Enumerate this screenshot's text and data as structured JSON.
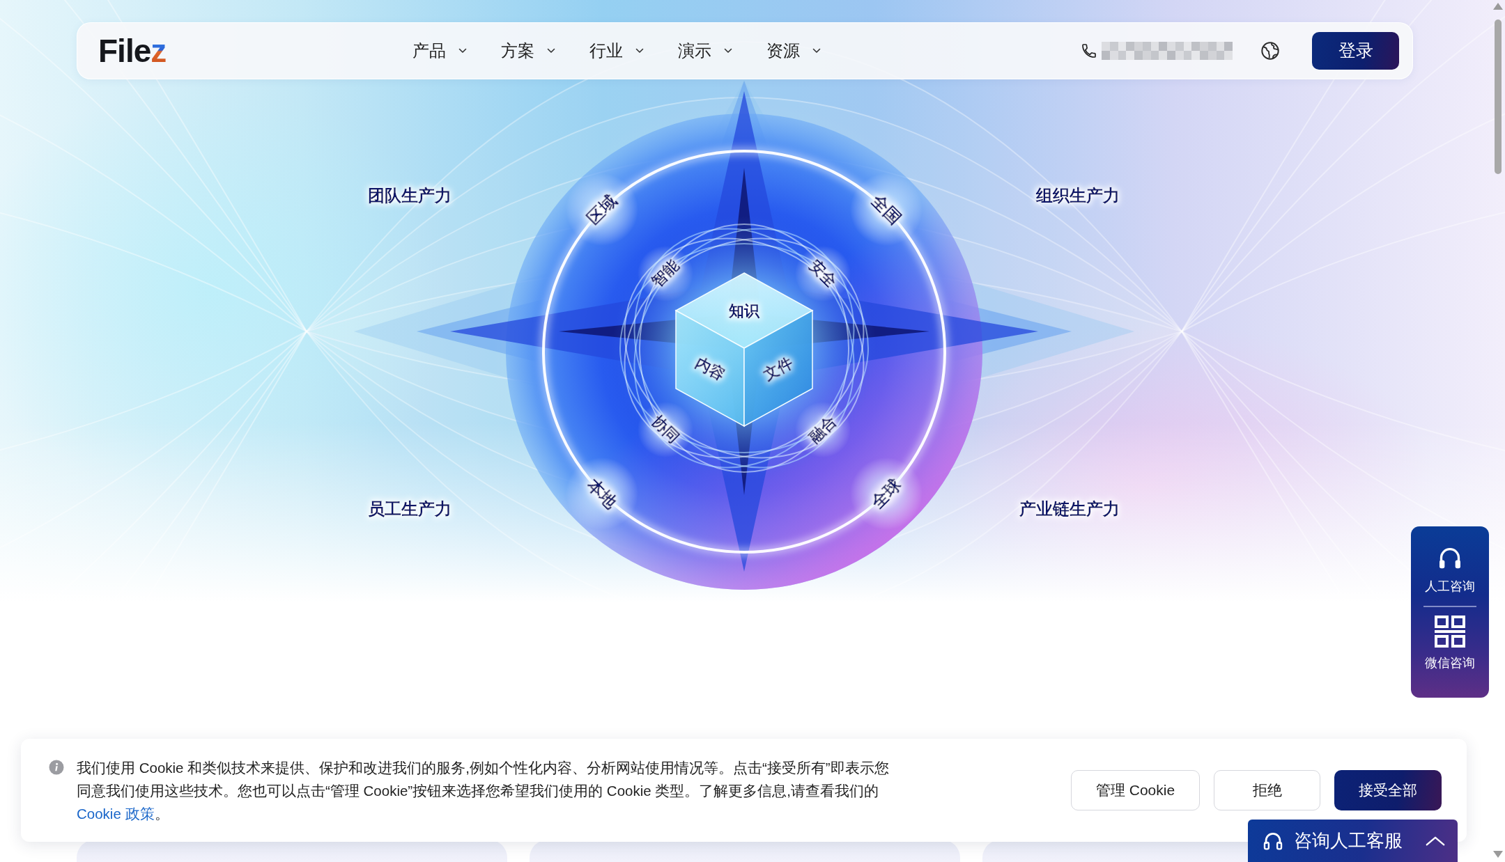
{
  "navbar": {
    "logo": "Filez",
    "menu": [
      {
        "label": "产品",
        "dropdown": true
      },
      {
        "label": "方案",
        "dropdown": true
      },
      {
        "label": "行业",
        "dropdown": true
      },
      {
        "label": "演示",
        "dropdown": true
      },
      {
        "label": "资源",
        "dropdown": true
      }
    ],
    "login_button": "登录"
  },
  "hero": {
    "corner_labels": [
      "团队生产力",
      "组织生产力",
      "员工生产力",
      "产业链生产力"
    ],
    "ring_labels": [
      "区域",
      "全国",
      "本地",
      "全球"
    ],
    "inner_labels": [
      "智能",
      "安全",
      "协同",
      "融合"
    ],
    "cube_labels": [
      "知识",
      "内容",
      "文件"
    ]
  },
  "side_widget": {
    "items": [
      {
        "kind": "headset",
        "label": "人工咨询"
      },
      {
        "kind": "qr",
        "label": "微信咨询"
      }
    ]
  },
  "cookie_banner": {
    "text": "我们使用 Cookie 和类似技术来提供、保护和改进我们的服务,例如个性化内容、分析网站使用情况等。点击“接受所有”即表示您同意我们使用这些技术。您也可以点击“管理 Cookie”按钮来选择您希望我们使用的 Cookie 类型。了解更多信息,请查看我们的",
    "link": "Cookie 政策",
    "text_end": "。",
    "buttons": [
      {
        "kind": "outline",
        "label": "管理 Cookie"
      },
      {
        "kind": "outline",
        "label": "拒绝"
      },
      {
        "kind": "primary",
        "label": "接受全部"
      }
    ]
  },
  "chat_button": {
    "label": "咨询人工客服"
  }
}
